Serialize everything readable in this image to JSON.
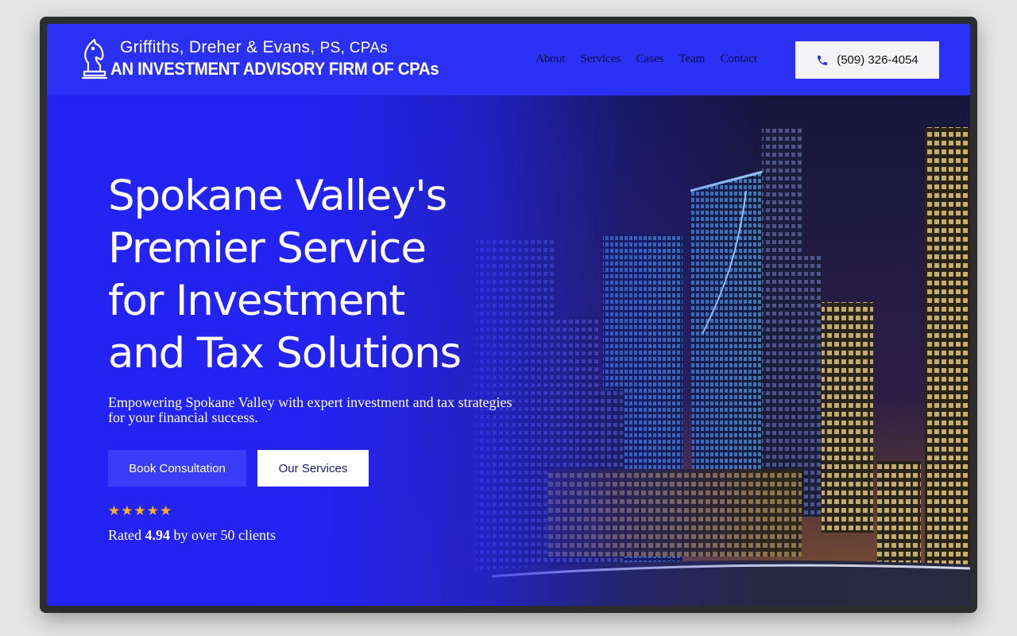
{
  "header": {
    "logo_line1_main": "Griffiths, Dreher & Evans,",
    "logo_line1_suffix": "PS, CPAs",
    "logo_line2": "AN INVESTMENT ADVISORY FIRM OF CPAs",
    "nav": [
      {
        "label": "About"
      },
      {
        "label": "Services"
      },
      {
        "label": "Cases"
      },
      {
        "label": "Team"
      },
      {
        "label": "Contact"
      }
    ],
    "phone": "(509) 326-4054"
  },
  "hero": {
    "title": "Spokane Valley's\nPremier Service\nfor Investment\nand Tax Solutions",
    "subtitle": "Empowering Spokane Valley with expert investment and tax strategies for your financial success.",
    "primary_button": "Book Consultation",
    "secondary_button": "Our Services",
    "stars": "★★★★★",
    "rating_prefix": "Rated",
    "rating_value": "4.94",
    "rating_suffix": "by over 50 clients"
  },
  "colors": {
    "brand_blue": "#2b30f5",
    "button_blue": "#3a3cf7",
    "star_gold": "#ffb21a"
  }
}
